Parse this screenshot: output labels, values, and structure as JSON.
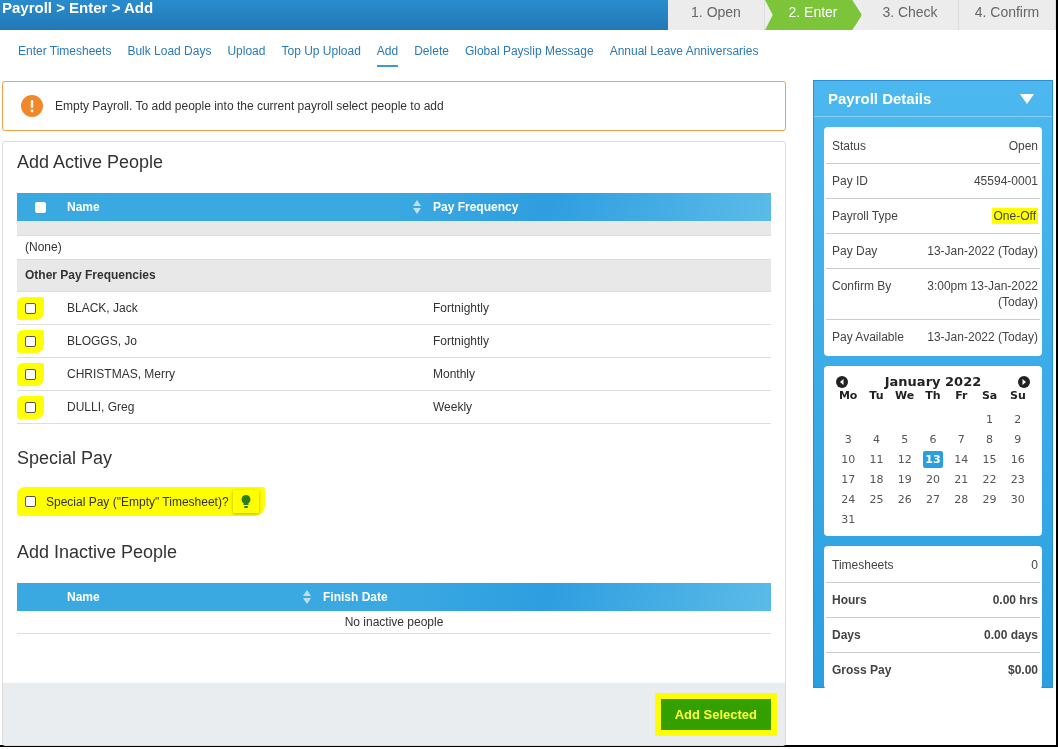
{
  "header": {
    "breadcrumb": "Payroll > Enter > Add",
    "steps": [
      {
        "label": "1. Open",
        "selected": false
      },
      {
        "label": "2. Enter",
        "selected": true
      },
      {
        "label": "3. Check",
        "selected": false
      },
      {
        "label": "4. Confirm",
        "selected": false
      }
    ]
  },
  "subnav": [
    {
      "label": "Enter Timesheets",
      "selected": false
    },
    {
      "label": "Bulk Load Days",
      "selected": false
    },
    {
      "label": "Upload",
      "selected": false
    },
    {
      "label": "Top Up Upload",
      "selected": false
    },
    {
      "label": "Add",
      "selected": true
    },
    {
      "label": "Delete",
      "selected": false
    },
    {
      "label": "Global Payslip Message",
      "selected": false
    },
    {
      "label": "Annual Leave Anniversaries",
      "selected": false
    }
  ],
  "alert": {
    "text": "Empty Payroll. To add people into the current payroll select people to add"
  },
  "active_people": {
    "title": "Add Active People",
    "select_all_checked": false,
    "columns": [
      "Name",
      "Pay Frequency"
    ],
    "groups": [
      {
        "kind": "empty",
        "label": "(None)"
      },
      {
        "kind": "header",
        "label": "Other Pay Frequencies"
      }
    ],
    "rows": [
      {
        "name": "BLACK, Jack",
        "frequency": "Fortnightly",
        "checked": false,
        "highlighted": true
      },
      {
        "name": "BLOGGS, Jo",
        "frequency": "Fortnightly",
        "checked": false,
        "highlighted": true
      },
      {
        "name": "CHRISTMAS, Merry",
        "frequency": "Monthly",
        "checked": false,
        "highlighted": true
      },
      {
        "name": "DULLI, Greg",
        "frequency": "Weekly",
        "checked": false,
        "highlighted": true
      }
    ]
  },
  "special_pay": {
    "title": "Special Pay",
    "label": "Special Pay (\"Empty\" Timesheet)?",
    "checked": false,
    "highlighted": true
  },
  "inactive_people": {
    "title": "Add Inactive People",
    "columns": [
      "Name",
      "Finish Date"
    ],
    "empty_text": "No inactive people"
  },
  "add_button": {
    "label": "Add Selected",
    "highlighted": true
  },
  "details": {
    "title": "Payroll Details",
    "rows": [
      {
        "label": "Status",
        "value": "Open",
        "highlighted": false
      },
      {
        "label": "Pay ID",
        "value": "45594-0001",
        "highlighted": false
      },
      {
        "label": "Payroll Type",
        "value": "One-Off",
        "highlighted": true
      },
      {
        "label": "Pay Day",
        "value": "13-Jan-2022 (Today)",
        "highlighted": false
      },
      {
        "label": "Confirm By",
        "value": "3:00pm 13-Jan-2022 (Today)",
        "highlighted": false
      },
      {
        "label": "Pay Available",
        "value": "13-Jan-2022 (Today)",
        "highlighted": false
      }
    ],
    "calendar": {
      "month": "January 2022",
      "weekdays": [
        "Mo",
        "Tu",
        "We",
        "Th",
        "Fr",
        "Sa",
        "Su"
      ],
      "weeks": [
        [
          {
            "day": "1",
            "selected": false
          },
          {
            "day": "2",
            "selected": false
          }
        ],
        [
          {
            "day": "3",
            "selected": false
          },
          {
            "day": "4",
            "selected": false
          },
          {
            "day": "5",
            "selected": false
          },
          {
            "day": "6",
            "selected": false
          },
          {
            "day": "7",
            "selected": false
          },
          {
            "day": "8",
            "selected": false
          },
          {
            "day": "9",
            "selected": false
          }
        ],
        [
          {
            "day": "10",
            "selected": false
          },
          {
            "day": "11",
            "selected": false
          },
          {
            "day": "12",
            "selected": false
          },
          {
            "day": "13",
            "selected": true
          },
          {
            "day": "14",
            "selected": false
          },
          {
            "day": "15",
            "selected": false
          },
          {
            "day": "16",
            "selected": false
          }
        ],
        [
          {
            "day": "17",
            "selected": false
          },
          {
            "day": "18",
            "selected": false
          },
          {
            "day": "19",
            "selected": false
          },
          {
            "day": "20",
            "selected": false
          },
          {
            "day": "21",
            "selected": false
          },
          {
            "day": "22",
            "selected": false
          },
          {
            "day": "23",
            "selected": false
          }
        ],
        [
          {
            "day": "24",
            "selected": false
          },
          {
            "day": "25",
            "selected": false
          },
          {
            "day": "26",
            "selected": false
          },
          {
            "day": "27",
            "selected": false
          },
          {
            "day": "28",
            "selected": false
          },
          {
            "day": "29",
            "selected": false
          },
          {
            "day": "30",
            "selected": false
          }
        ],
        [
          {
            "day": "31",
            "selected": false
          }
        ]
      ]
    },
    "totals": [
      {
        "label": "Timesheets",
        "value": "0",
        "bold": false
      },
      {
        "label": "Hours",
        "value": "0.00 hrs",
        "bold": true
      },
      {
        "label": "Days",
        "value": "0.00 days",
        "bold": true
      },
      {
        "label": "Gross Pay",
        "value": "$0.00",
        "bold": true
      }
    ]
  }
}
